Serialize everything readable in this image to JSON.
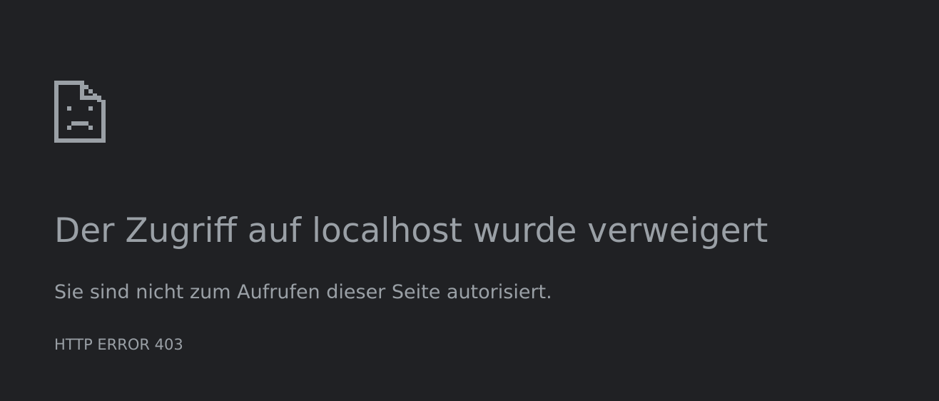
{
  "error_page": {
    "icon": "sad-document-icon",
    "title": "Der Zugriff auf localhost wurde verweigert",
    "message": "Sie sind nicht zum Aufrufen dieser Seite autorisiert.",
    "error_code": "HTTP ERROR 403"
  },
  "colors": {
    "background": "#202124",
    "text": "#9aa0a6",
    "icon": "#9aa0a6"
  }
}
